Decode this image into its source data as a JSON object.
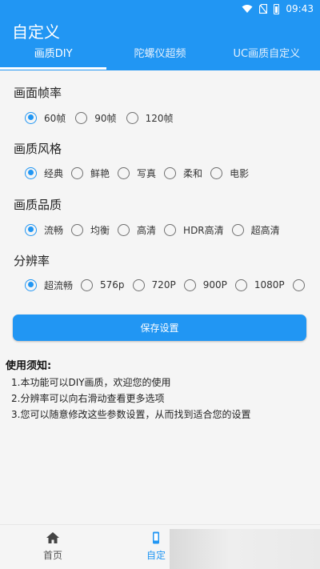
{
  "status_bar": {
    "time": "09:43"
  },
  "header": {
    "title": "自定义",
    "tabs": [
      {
        "label": "画质DIY",
        "active": true
      },
      {
        "label": "陀螺仪超频",
        "active": false
      },
      {
        "label": "UC画质自定义",
        "active": false
      }
    ]
  },
  "settings": [
    {
      "title": "画面帧率",
      "options": [
        "60帧",
        "90帧",
        "120帧"
      ],
      "selected": "60帧"
    },
    {
      "title": "画质风格",
      "options": [
        "经典",
        "鲜艳",
        "写真",
        "柔和",
        "电影"
      ],
      "selected": "经典"
    },
    {
      "title": "画质品质",
      "options": [
        "流畅",
        "均衡",
        "高清",
        "HDR高清",
        "超高清"
      ],
      "selected": "流畅"
    },
    {
      "title": "分辨率",
      "options": [
        "超流畅",
        "576p",
        "720P",
        "900P",
        "1080P",
        ""
      ],
      "selected": "超流畅"
    }
  ],
  "save_button": {
    "label": "保存设置"
  },
  "notes": {
    "title": "使用须知:",
    "items": [
      "1.本功能可以DIY画质，欢迎您的使用",
      "2.分辨率可以向右滑动查看更多选项",
      "3.您可以随意修改这些参数设置，从而找到适合您的设置"
    ]
  },
  "bottom_nav": [
    {
      "label": "首页",
      "icon": "home-icon",
      "active": false
    },
    {
      "label": "自定",
      "icon": "phone-icon",
      "active": true
    }
  ],
  "colors": {
    "primary": "#2196f3",
    "background": "#f5f5f5"
  }
}
